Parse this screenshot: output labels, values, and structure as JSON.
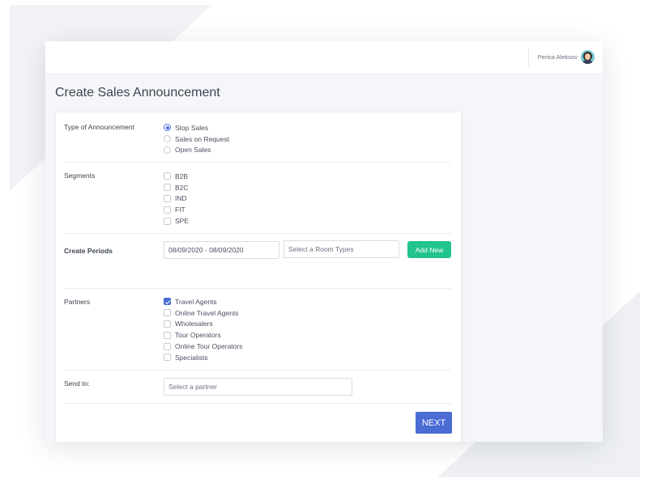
{
  "header": {
    "user_name": "Perica Aleksov",
    "avatar_icon": "user-avatar"
  },
  "page": {
    "title": "Create Sales Announcement"
  },
  "form": {
    "announcement_type": {
      "label": "Type of Announcement",
      "options": [
        {
          "label": "Stop Sales",
          "selected": true
        },
        {
          "label": "Sales on Request",
          "selected": false
        },
        {
          "label": "Open Sales",
          "selected": false
        }
      ]
    },
    "segments": {
      "label": "Segments",
      "options": [
        {
          "label": "B2B",
          "checked": false
        },
        {
          "label": "B2C",
          "checked": false
        },
        {
          "label": "IND",
          "checked": false
        },
        {
          "label": "FIT",
          "checked": false
        },
        {
          "label": "SPE",
          "checked": false
        }
      ]
    },
    "periods": {
      "label": "Create Periods",
      "date_range_value": "08/09/2020 - 08/09/2020",
      "room_types_placeholder": "Select a Room Types",
      "add_new_label": "Add New"
    },
    "partners": {
      "label": "Partners",
      "options": [
        {
          "label": "Travel Agents",
          "checked": true
        },
        {
          "label": "Online Travel Agents",
          "checked": false
        },
        {
          "label": "Wholesalers",
          "checked": false
        },
        {
          "label": "Tour Operators",
          "checked": false
        },
        {
          "label": "Online Tour Operators",
          "checked": false
        },
        {
          "label": "Specialists",
          "checked": false
        }
      ]
    },
    "send_to": {
      "label": "Send to:",
      "placeholder": "Select a partner"
    },
    "next_label": "NEXT"
  },
  "colors": {
    "primary": "#4a6cd4",
    "success": "#22c38e",
    "text": "#3d4450",
    "background": "#f5f6fa"
  }
}
